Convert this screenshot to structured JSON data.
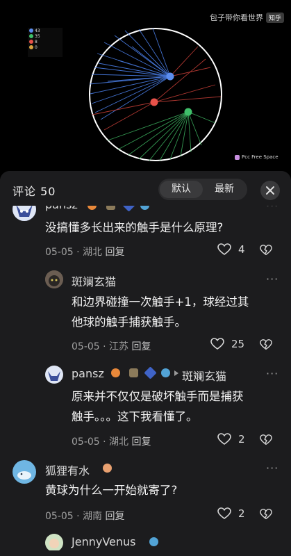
{
  "watermark": {
    "text": "包子带你看世界",
    "brand": "知乎"
  },
  "legend": [
    {
      "value": "43",
      "color": "#5b8def"
    },
    {
      "value": "35",
      "color": "#3fbf6a"
    },
    {
      "value": "8",
      "color": "#e8524a"
    },
    {
      "value": "0",
      "color": "#d9a441"
    }
  ],
  "credit": "Pcc Free Space",
  "sheet": {
    "title": "评论 50",
    "sort_default": "默认",
    "sort_latest": "最新"
  },
  "comments": [
    {
      "name": "pansz",
      "text_line1": "没搞懂多长出来的触手是什么原理?",
      "date": "05-05",
      "location": "湖北",
      "reply": "回复",
      "likes": "4"
    },
    {
      "name": "斑斓玄猫",
      "text_line1": "和边界碰撞一次触手+1，球经过其",
      "text_line2": "他球的触手捕获触手。",
      "date": "05-05",
      "location": "江苏",
      "reply": "回复",
      "likes": "25"
    },
    {
      "name": "pansz",
      "reply_to": "斑斓玄猫",
      "text_line1": "原来并不仅仅是破坏触手而是捕获",
      "text_line2": "触手。。。这下我看懂了。",
      "date": "05-05",
      "location": "湖北",
      "reply": "回复",
      "likes": "2"
    },
    {
      "name": "狐狸有水",
      "text_line1": "黄球为什么一开始就寄了?",
      "date": "05-05",
      "location": "湖南",
      "reply": "回复",
      "likes": "2"
    },
    {
      "name": "JennyVenus"
    }
  ],
  "more_label": "···",
  "separator": "·"
}
